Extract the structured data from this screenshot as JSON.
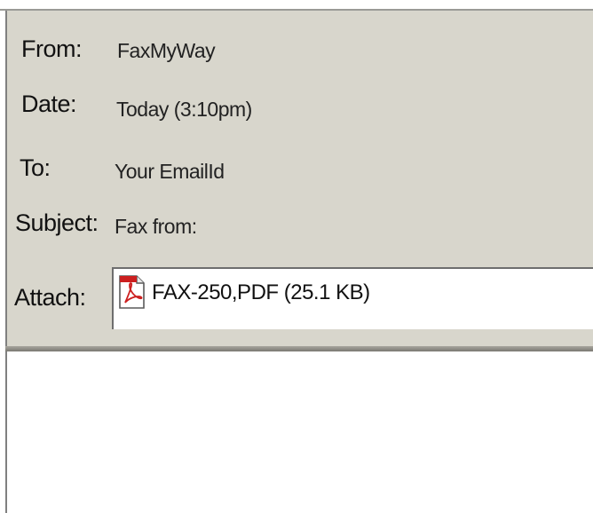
{
  "message_header": {
    "from": {
      "label": "From:",
      "value": "FaxMyWay"
    },
    "date": {
      "label": "Date:",
      "value": "Today (3:10pm)"
    },
    "to": {
      "label": "To:",
      "value": "Your EmailId"
    },
    "subject": {
      "label": "Subject:",
      "value": "Fax from:"
    },
    "attach": {
      "label": "Attach:",
      "file_name": "FAX-250,PDF (25.1 KB)",
      "icon": "pdf-file-icon"
    }
  },
  "colors": {
    "panel_background": "#d8d6cc",
    "body_background": "#ffffff",
    "pdf_red": "#cc1f1f"
  }
}
